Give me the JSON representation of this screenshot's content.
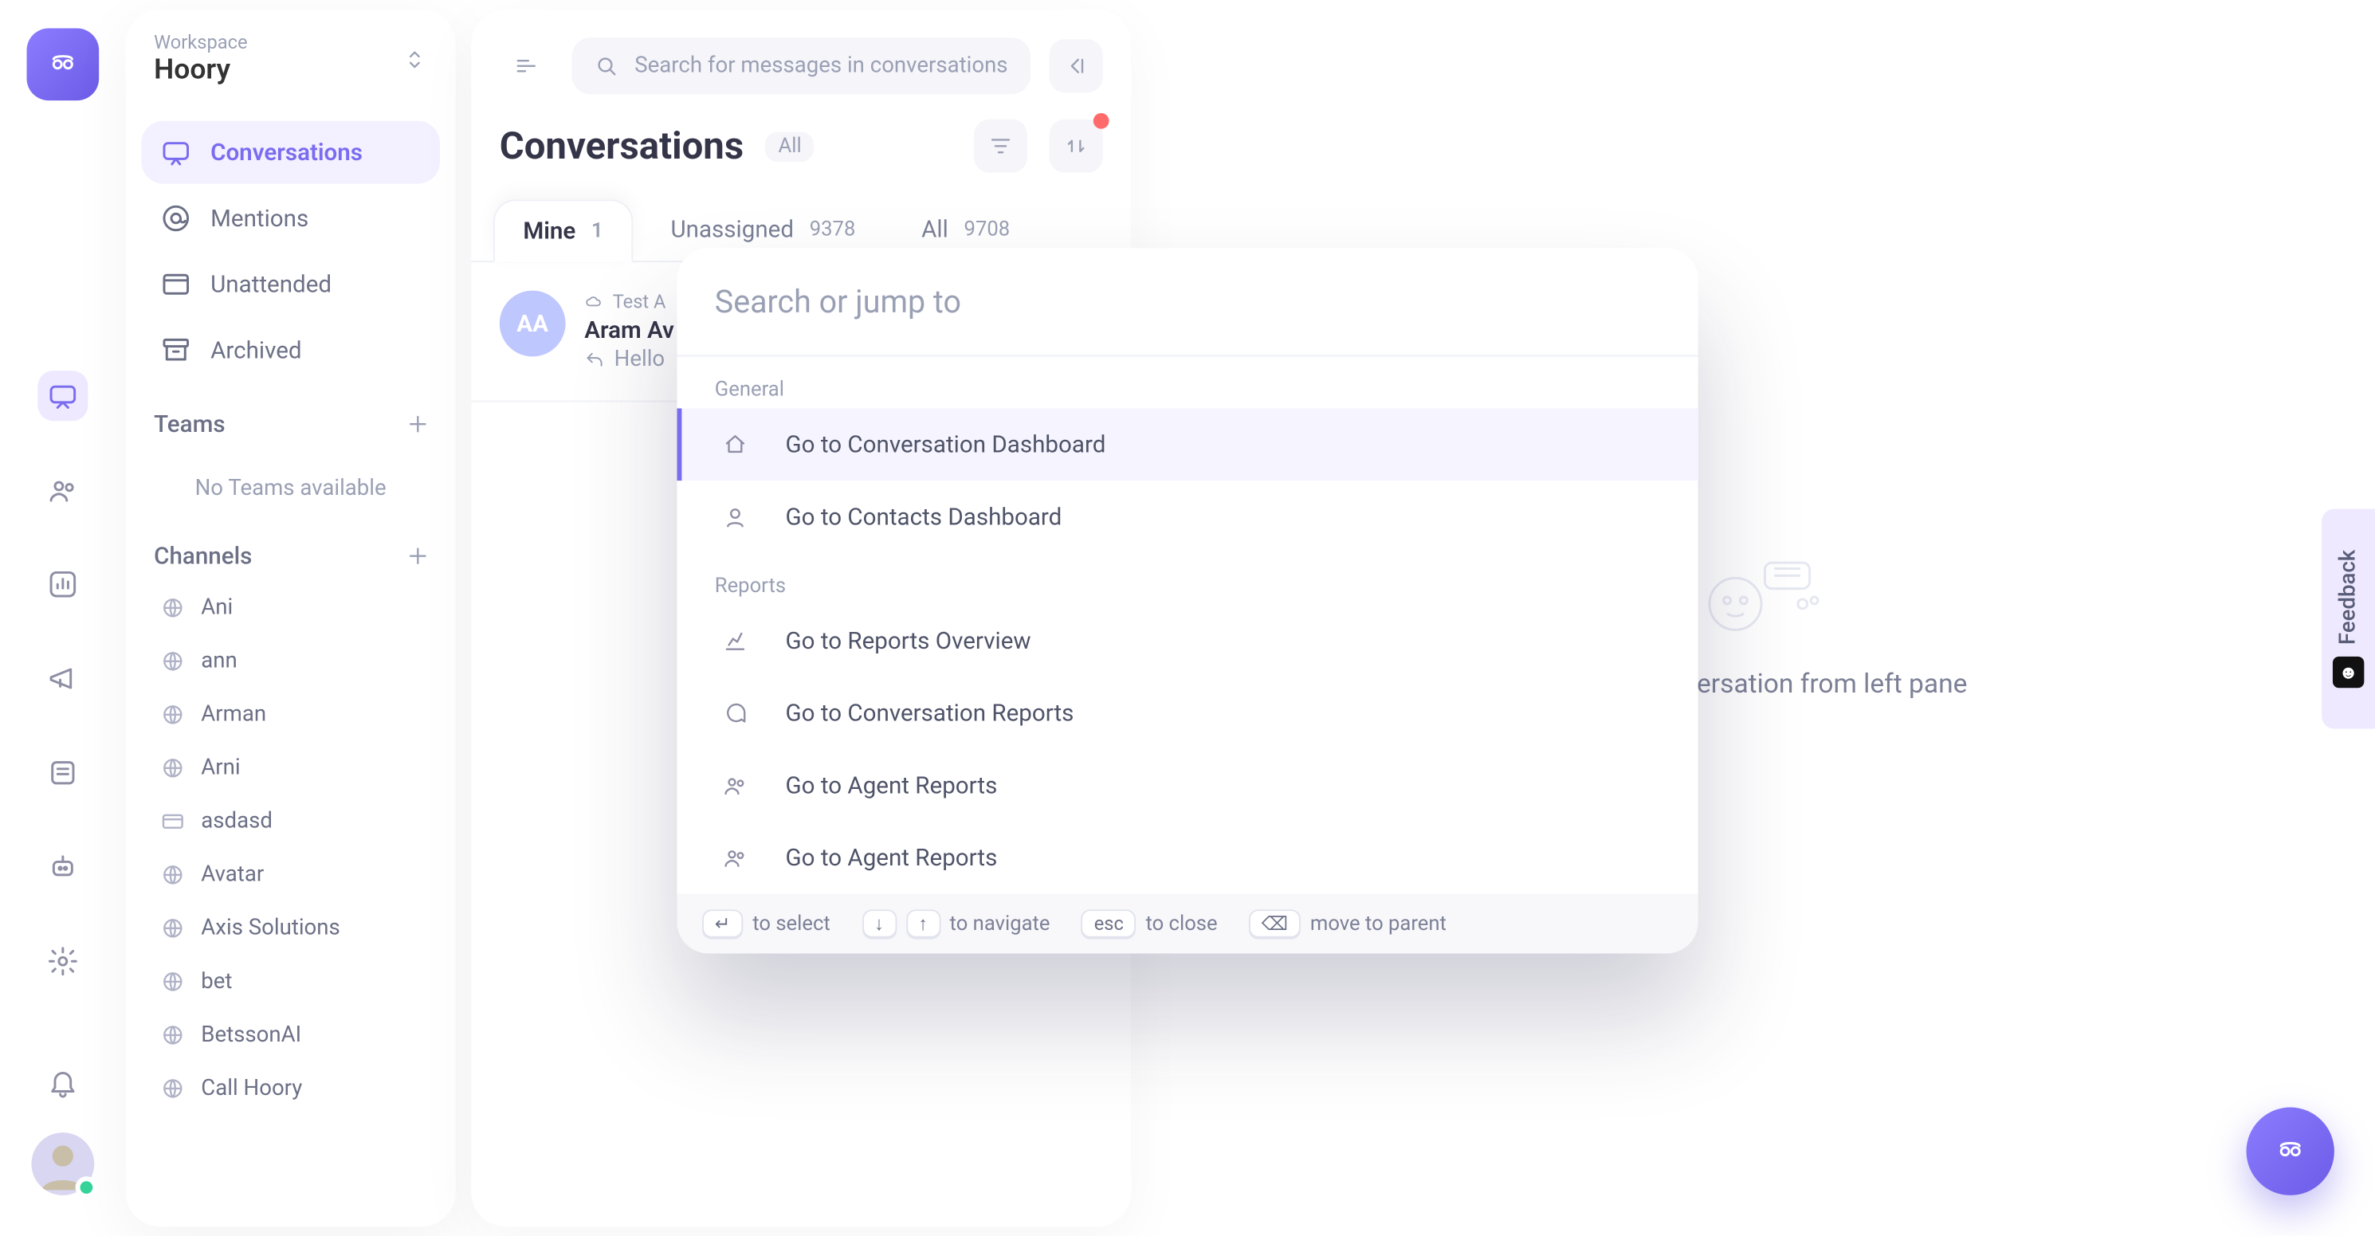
{
  "workspace": {
    "label": "Workspace",
    "name": "Hoory"
  },
  "nav": {
    "conversations": "Conversations",
    "mentions": "Mentions",
    "unattended": "Unattended",
    "archived": "Archived"
  },
  "teams": {
    "header": "Teams",
    "empty": "No Teams available"
  },
  "channels": {
    "header": "Channels",
    "items": [
      "Ani",
      "ann",
      "Arman",
      "Arni",
      "asdasd",
      "Avatar",
      "Axis Solutions",
      "bet",
      "BetssonAI",
      "Call Hoory"
    ]
  },
  "search_placeholder": "Search for messages in conversations",
  "list": {
    "title": "Conversations",
    "scope": "All",
    "tabs": [
      {
        "label": "Mine",
        "count": "1"
      },
      {
        "label": "Unassigned",
        "count": "9378"
      },
      {
        "label": "All",
        "count": "9708"
      }
    ]
  },
  "conversation": {
    "initials": "AA",
    "channel": "Test A",
    "name": "Aram Av",
    "preview": "Hello"
  },
  "empty_main": "Select a conversation from left pane",
  "palette": {
    "placeholder": "Search or jump to",
    "sections": [
      {
        "title": "General",
        "items": [
          {
            "icon": "home",
            "label": "Go to Conversation Dashboard",
            "selected": true
          },
          {
            "icon": "user",
            "label": "Go to Contacts Dashboard"
          }
        ]
      },
      {
        "title": "Reports",
        "items": [
          {
            "icon": "chart",
            "label": "Go to Reports Overview"
          },
          {
            "icon": "chat",
            "label": "Go to Conversation Reports"
          },
          {
            "icon": "people",
            "label": "Go to Agent Reports"
          },
          {
            "icon": "people",
            "label": "Go to Agent Reports"
          }
        ]
      }
    ],
    "footer": {
      "select": "to select",
      "navigate": "to navigate",
      "close": "to close",
      "parent": "move to parent",
      "esc": "esc"
    }
  },
  "feedback": "Feedback"
}
